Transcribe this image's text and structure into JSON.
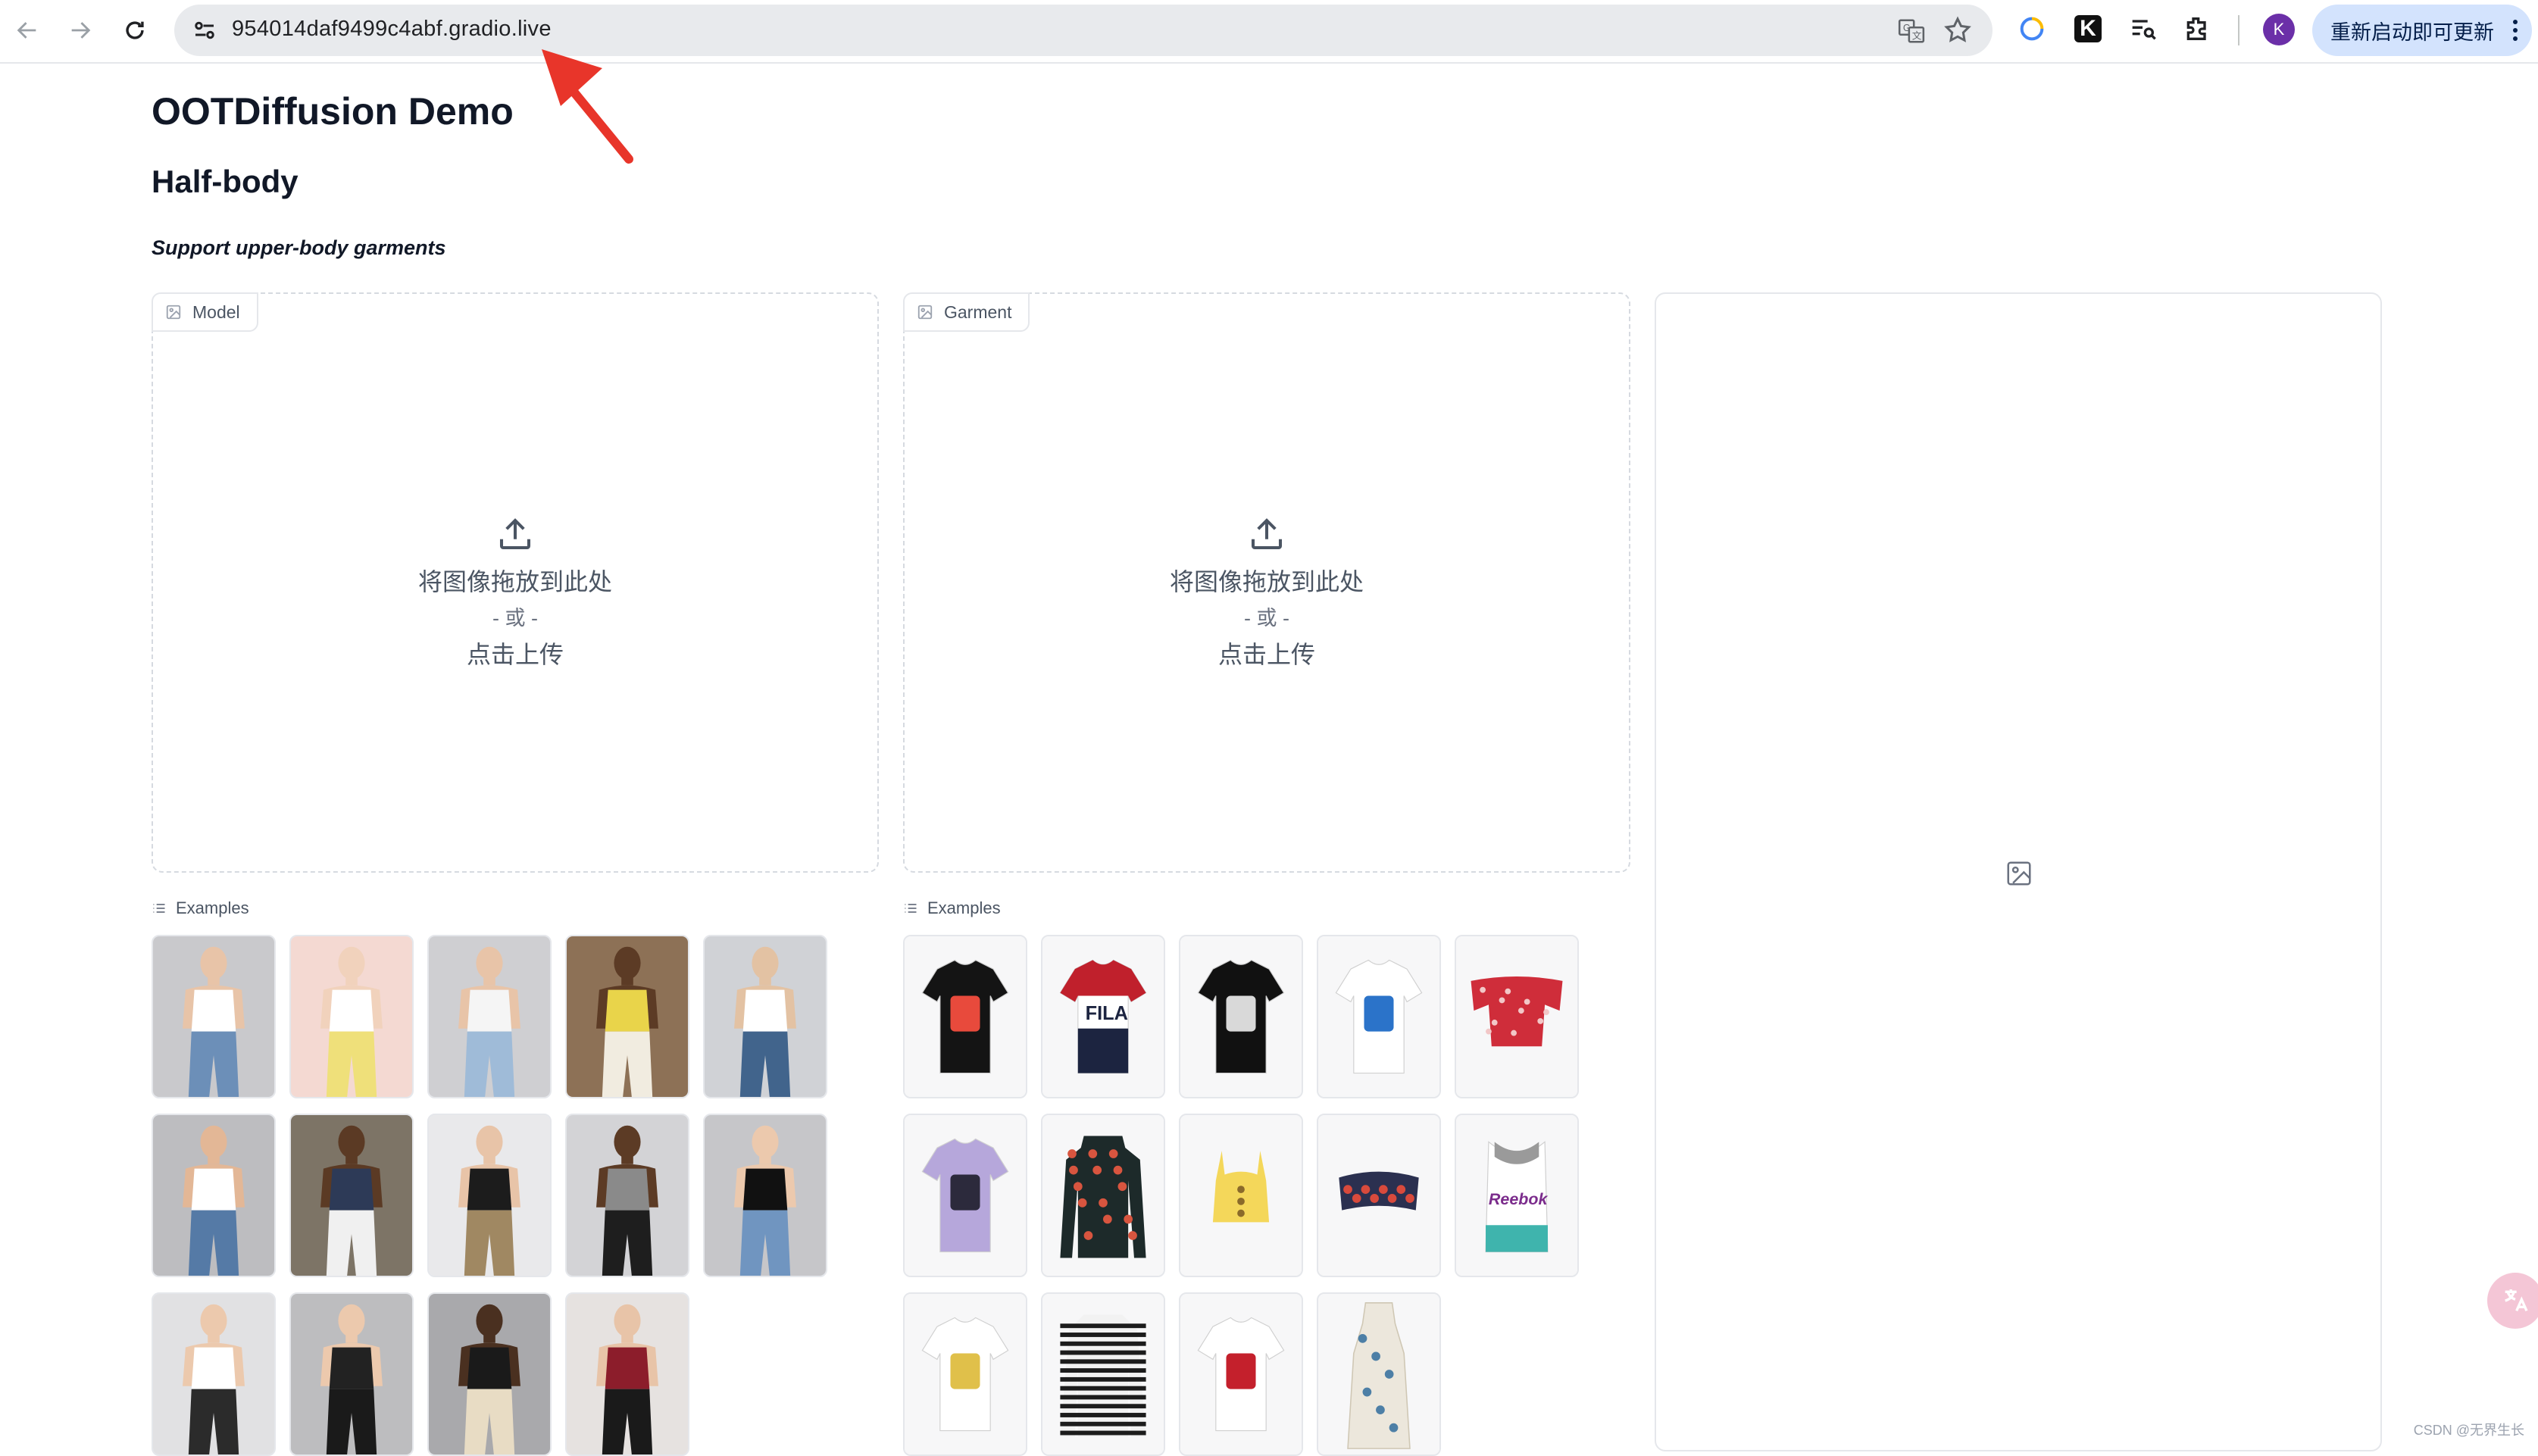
{
  "browser": {
    "url": "954014daf9499c4abf.gradio.live",
    "update_button": "重新启动即可更新",
    "avatar_letter": "K"
  },
  "page": {
    "title": "OOTDiffusion Demo",
    "subtitle": "Half-body",
    "description": "Support upper-body garments"
  },
  "model_panel": {
    "label": "Model",
    "drop_text": "将图像拖放到此处",
    "or_text": "- 或 -",
    "click_text": "点击上传",
    "examples_label": "Examples"
  },
  "garment_panel": {
    "label": "Garment",
    "drop_text": "将图像拖放到此处",
    "or_text": "- 或 -",
    "click_text": "点击上传",
    "examples_label": "Examples"
  },
  "model_examples": [
    {
      "bg": "#c9c9cc",
      "top": "#ffffff",
      "bottom": "#6c8fb8",
      "skin": "#e8c4a8"
    },
    {
      "bg": "#f4d9d2",
      "top": "#ffffff",
      "bottom": "#efe07a",
      "skin": "#f1d2bc"
    },
    {
      "bg": "#cfcfd2",
      "top": "#f5f5f5",
      "bottom": "#9fbbd8",
      "skin": "#e8c4a8"
    },
    {
      "bg": "#8d7156",
      "top": "#e9d44a",
      "bottom": "#f1ece0",
      "skin": "#5c3b25"
    },
    {
      "bg": "#d0d2d6",
      "top": "#ffffff",
      "bottom": "#41648c",
      "skin": "#e3c2a3"
    },
    {
      "bg": "#bdbdc0",
      "top": "#ffffff",
      "bottom": "#557aa6",
      "skin": "#e3b796"
    },
    {
      "bg": "#7d7466",
      "top": "#2d3a57",
      "bottom": "#f0f0f0",
      "skin": "#5b3a24"
    },
    {
      "bg": "#e9e9eb",
      "top": "#1c1c1c",
      "bottom": "#a08862",
      "skin": "#e8c4a8"
    },
    {
      "bg": "#d3d3d6",
      "top": "#8a8a8a",
      "bottom": "#1e1e1e",
      "skin": "#5c3b25"
    },
    {
      "bg": "#c6c6c9",
      "top": "#111111",
      "bottom": "#7095c0",
      "skin": "#ecc9ad"
    },
    {
      "bg": "#e1e1e3",
      "top": "#ffffff",
      "bottom": "#2b2b2b",
      "skin": "#ecc9ad"
    },
    {
      "bg": "#bdbdbf",
      "top": "#222222",
      "bottom": "#1a1a1a",
      "skin": "#ecc9ad"
    },
    {
      "bg": "#a9a9ac",
      "top": "#1a1a1a",
      "bottom": "#e8dcc4",
      "skin": "#4a3020"
    },
    {
      "bg": "#e6e2e0",
      "top": "#8c1d2b",
      "bottom": "#1a1a1a",
      "skin": "#e8c4a8"
    }
  ],
  "garment_examples": [
    {
      "color": "#141414",
      "accent": "#e84a3c",
      "kind": "tee"
    },
    {
      "color": "#ffffff",
      "accent": "#c0202c",
      "accent2": "#1c2440",
      "kind": "fila"
    },
    {
      "color": "#111111",
      "accent": "#d9d9d9",
      "kind": "tee"
    },
    {
      "color": "#ffffff",
      "accent": "#2b73c9",
      "kind": "tee"
    },
    {
      "color": "#cf2d3a",
      "accent": "#f2c7c7",
      "kind": "offshoulder"
    },
    {
      "color": "#b6a7db",
      "accent": "#2c2a3c",
      "kind": "tee"
    },
    {
      "color": "#1d2a2a",
      "accent": "#d8553f",
      "kind": "longsleeve"
    },
    {
      "color": "#f4d75a",
      "accent": "#8a6a2a",
      "kind": "crop"
    },
    {
      "color": "#2b3050",
      "accent": "#d84a3c",
      "kind": "bandeau"
    },
    {
      "color": "#ffffff",
      "accent": "#7b2c8c",
      "accent2": "#3fb4ad",
      "kind": "reebok"
    },
    {
      "color": "#ffffff",
      "accent": "#e0c04a",
      "kind": "tee"
    },
    {
      "color": "#1c1c1c",
      "accent": "#f2f2f2",
      "kind": "stripes"
    },
    {
      "color": "#ffffff",
      "accent": "#c4202c",
      "kind": "tee"
    },
    {
      "color": "#ece7dc",
      "accent": "#4d7fa6",
      "kind": "dress"
    }
  ]
}
